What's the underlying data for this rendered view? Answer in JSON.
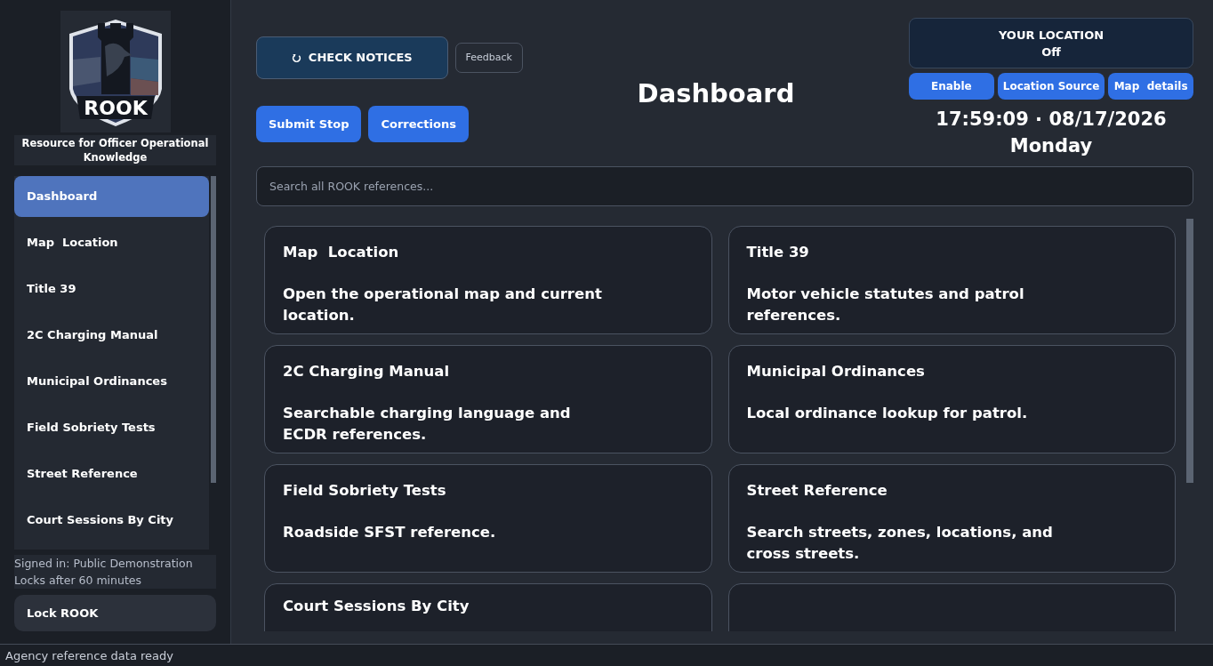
{
  "sidebar": {
    "logo_text": "ROOK",
    "tagline": "Resource for Officer Operational Knowledge",
    "items": [
      {
        "label": "Dashboard",
        "selected": true
      },
      {
        "label": "Map  Location",
        "selected": false
      },
      {
        "label": "Title 39",
        "selected": false
      },
      {
        "label": "2C Charging Manual",
        "selected": false
      },
      {
        "label": "Municipal Ordinances",
        "selected": false
      },
      {
        "label": "Field Sobriety Tests",
        "selected": false
      },
      {
        "label": "Street Reference",
        "selected": false
      },
      {
        "label": "Court Sessions By City",
        "selected": false
      }
    ],
    "signed_in": "Signed in: Public Demonstration",
    "lock_note": "Locks after 60 minutes",
    "lock_button": "Lock ROOK"
  },
  "header": {
    "check_notices": "CHECK NOTICES",
    "feedback": "Feedback",
    "actions": [
      "Submit Stop",
      "Corrections"
    ],
    "title": "Dashboard",
    "location": {
      "heading": "YOUR LOCATION",
      "status": "Off",
      "buttons": [
        "Enable",
        "Location Source",
        "Map  details"
      ]
    },
    "clock": "17:59:09 · 08/17/2026",
    "weekday": "Monday"
  },
  "search": {
    "placeholder": "Search all ROOK references..."
  },
  "cards": [
    {
      "title": "Map  Location",
      "description": "Open the operational map and current location."
    },
    {
      "title": "Title 39",
      "description": "Motor vehicle statutes and patrol references."
    },
    {
      "title": "2C Charging Manual",
      "description": "Searchable charging language and ECDR references."
    },
    {
      "title": "Municipal Ordinances",
      "description": "Local ordinance lookup for patrol."
    },
    {
      "title": "Field Sobriety Tests",
      "description": "Roadside SFST reference."
    },
    {
      "title": "Street Reference",
      "description": "Search streets, zones, locations, and cross streets."
    },
    {
      "title": "Court Sessions By City"
    }
  ],
  "status_bar": "Agency reference data ready"
}
